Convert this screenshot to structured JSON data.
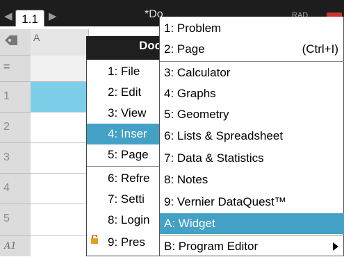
{
  "top_bar": {
    "tab_label": "1.1",
    "doc_title": "*Do",
    "status_text": "RAD"
  },
  "spreadsheet": {
    "column_header": "A",
    "rows": [
      "1",
      "2",
      "3",
      "4",
      "5"
    ],
    "cell_ref": "A1"
  },
  "main_menu": {
    "title": "Doc",
    "items": [
      {
        "label": "1: File"
      },
      {
        "label": "2: Edit"
      },
      {
        "label": "3: View"
      },
      {
        "label": "4: Inser"
      },
      {
        "label": "5: Page"
      },
      {
        "label": "6: Refre"
      },
      {
        "label": "7: Setti"
      },
      {
        "label": "8: Login"
      },
      {
        "label": "9: Pres"
      }
    ]
  },
  "insert_menu": {
    "items": [
      {
        "label": "1: Problem"
      },
      {
        "label": "2: Page",
        "shortcut": "(Ctrl+I)"
      },
      {
        "label": "3: Calculator"
      },
      {
        "label": "4: Graphs"
      },
      {
        "label": "5: Geometry"
      },
      {
        "label": "6: Lists & Spreadsheet"
      },
      {
        "label": "7: Data & Statistics"
      },
      {
        "label": "8: Notes"
      },
      {
        "label": "9: Vernier DataQuest™"
      },
      {
        "label": "A: Widget"
      },
      {
        "label": "B: Program Editor"
      }
    ]
  },
  "colors": {
    "selection": "#43a1c6",
    "header_bg": "#1d1d1d",
    "row_header_bg": "#dcdcdc"
  }
}
